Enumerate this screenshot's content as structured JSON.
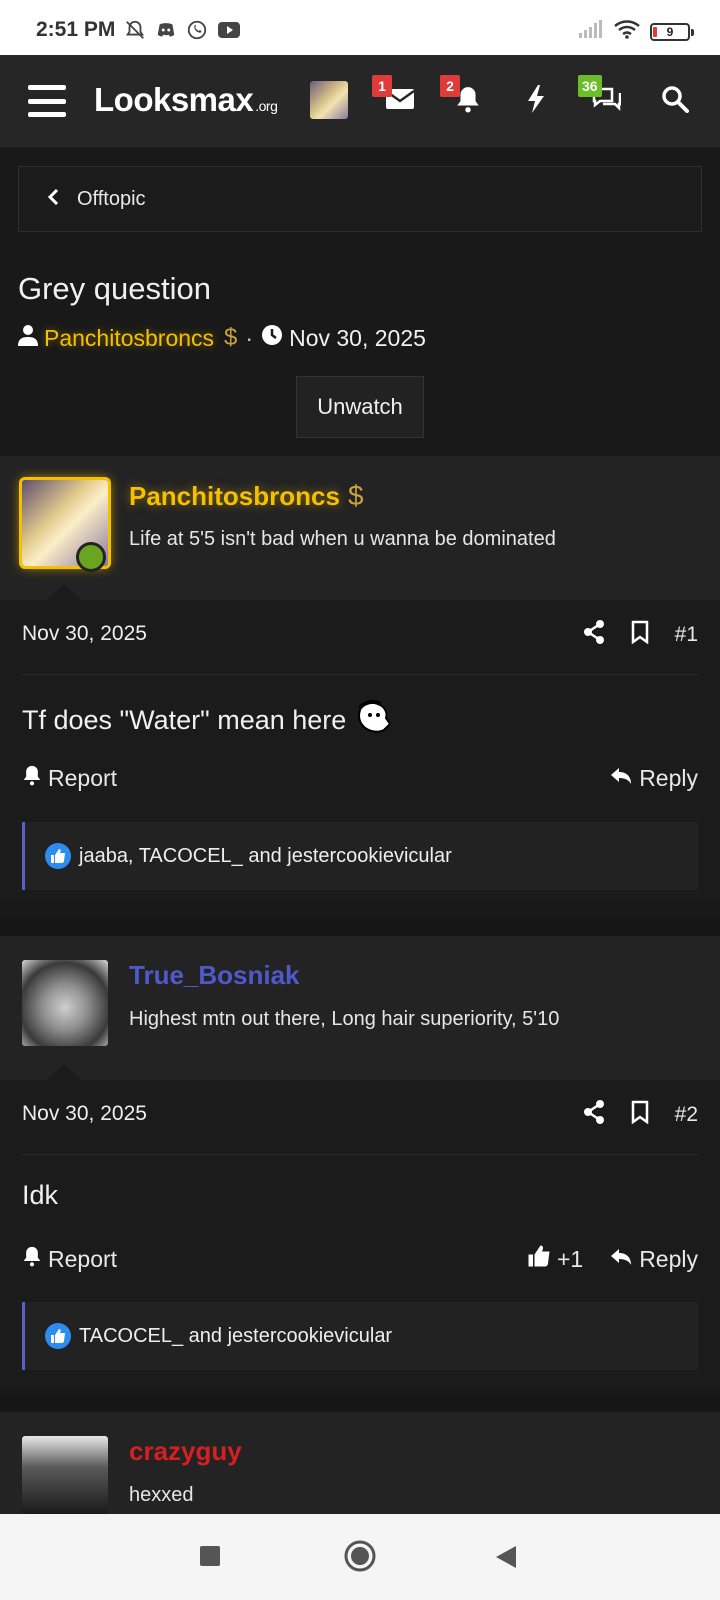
{
  "status_bar": {
    "time": "2:51 PM",
    "battery": "9"
  },
  "nav": {
    "logo": "Looksmax",
    "logo_suffix": ".org",
    "inbox_count": "1",
    "alerts_count": "2",
    "chat_count": "36"
  },
  "breadcrumb": {
    "label": "Offtopic"
  },
  "thread": {
    "title": "Grey question",
    "author": "Panchitosbroncs",
    "date": "Nov 30, 2025",
    "unwatch_label": "Unwatch"
  },
  "posts": [
    {
      "author": "Panchitosbroncs",
      "author_color": "#f5c000",
      "user_title": "Life at 5'5 isn't bad when u wanna be dominated",
      "date": "Nov 30, 2025",
      "number": "#1",
      "text": "Tf does \"Water\" mean here",
      "report_label": "Report",
      "reply_label": "Reply",
      "reactions": "jaaba, TACOCEL_ and jestercookievicular"
    },
    {
      "author": "True_Bosniak",
      "author_color": "#5059c9",
      "user_title": "Highest mtn out there, Long hair superiority, 5'10",
      "date": "Nov 30, 2025",
      "number": "#2",
      "text": "Idk",
      "report_label": "Report",
      "plus_label": "+1",
      "reply_label": "Reply",
      "reactions": "TACOCEL_ and jestercookievicular"
    },
    {
      "author": "crazyguy",
      "author_color": "#d42020",
      "user_title": "hexxed"
    }
  ],
  "colors": {
    "background": "#191919",
    "accent_gold": "#f5c000",
    "reaction_border": "#5a5fc8",
    "like_blue": "#2d8cf0"
  }
}
